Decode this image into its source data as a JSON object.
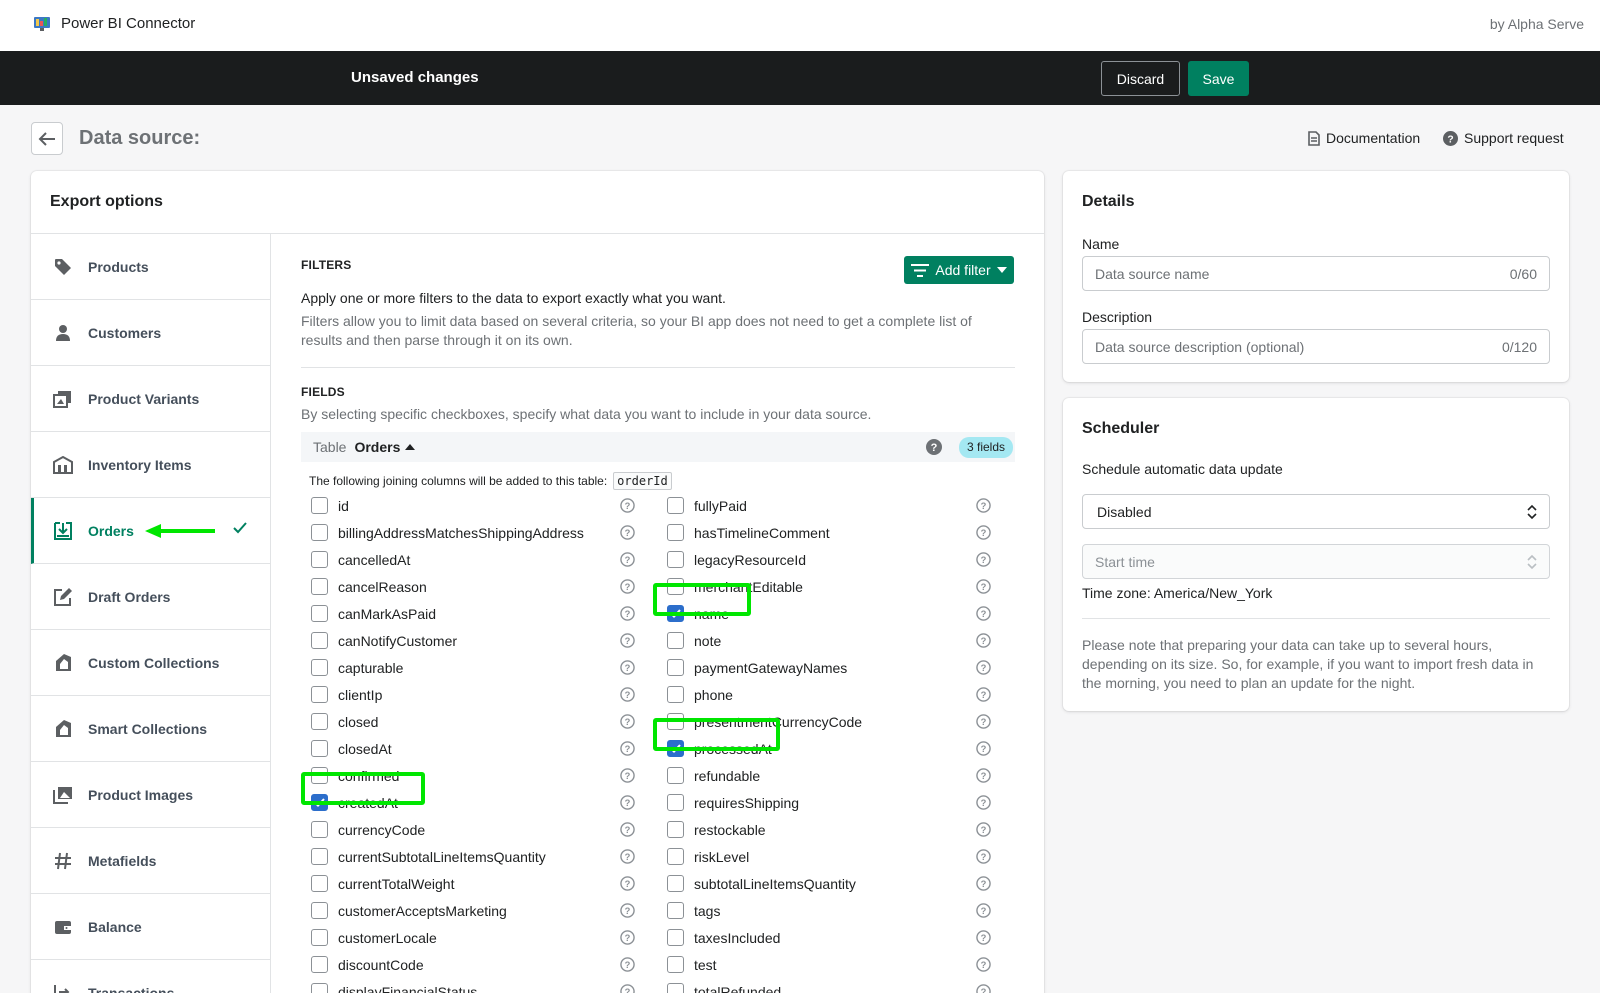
{
  "app": {
    "title": "Power BI Connector",
    "vendor": "by Alpha Serve"
  },
  "savebar": {
    "message": "Unsaved changes",
    "discard": "Discard",
    "save": "Save"
  },
  "page": {
    "title": "Data source:",
    "documentation": "Documentation",
    "support": "Support request"
  },
  "export": {
    "title": "Export options",
    "sidebar": [
      {
        "label": "Products",
        "icon": "tag-icon"
      },
      {
        "label": "Customers",
        "icon": "person-icon"
      },
      {
        "label": "Product Variants",
        "icon": "variants-icon"
      },
      {
        "label": "Inventory Items",
        "icon": "inventory-icon"
      },
      {
        "label": "Orders",
        "icon": "orders-icon",
        "active": true
      },
      {
        "label": "Draft Orders",
        "icon": "draft-orders-icon"
      },
      {
        "label": "Custom Collections",
        "icon": "collections-icon"
      },
      {
        "label": "Smart Collections",
        "icon": "collections-icon"
      },
      {
        "label": "Product Images",
        "icon": "images-icon"
      },
      {
        "label": "Metafields",
        "icon": "hash-icon"
      },
      {
        "label": "Balance",
        "icon": "wallet-icon"
      },
      {
        "label": "Transactions",
        "icon": "transactions-icon"
      }
    ],
    "filters": {
      "title": "FILTERS",
      "add_filter": "Add filter",
      "line1": "Apply one or more filters to the data to export exactly what you want.",
      "line2": "Filters allow you to limit data based on several criteria, so your BI app does not need to get a complete list of results and then parse through it on its own."
    },
    "fields": {
      "title": "FIELDS",
      "description": "By selecting specific checkboxes, specify what data you want to include in your data source.",
      "table_label": "Table",
      "table_name": "Orders",
      "count_badge": "3 fields",
      "join_note": "The following joining columns will be added to this table:",
      "join_column": "orderId",
      "left": [
        {
          "name": "id",
          "checked": false
        },
        {
          "name": "billingAddressMatchesShippingAddress",
          "checked": false
        },
        {
          "name": "cancelledAt",
          "checked": false
        },
        {
          "name": "cancelReason",
          "checked": false
        },
        {
          "name": "canMarkAsPaid",
          "checked": false
        },
        {
          "name": "canNotifyCustomer",
          "checked": false
        },
        {
          "name": "capturable",
          "checked": false
        },
        {
          "name": "clientIp",
          "checked": false
        },
        {
          "name": "closed",
          "checked": false
        },
        {
          "name": "closedAt",
          "checked": false
        },
        {
          "name": "confirmed",
          "checked": false
        },
        {
          "name": "createdAt",
          "checked": true
        },
        {
          "name": "currencyCode",
          "checked": false
        },
        {
          "name": "currentSubtotalLineItemsQuantity",
          "checked": false
        },
        {
          "name": "currentTotalWeight",
          "checked": false
        },
        {
          "name": "customerAcceptsMarketing",
          "checked": false
        },
        {
          "name": "customerLocale",
          "checked": false
        },
        {
          "name": "discountCode",
          "checked": false
        },
        {
          "name": "displayFinancialStatus",
          "checked": false
        }
      ],
      "right": [
        {
          "name": "fullyPaid",
          "checked": false
        },
        {
          "name": "hasTimelineComment",
          "checked": false
        },
        {
          "name": "legacyResourceId",
          "checked": false
        },
        {
          "name": "merchantEditable",
          "checked": false
        },
        {
          "name": "name",
          "checked": true
        },
        {
          "name": "note",
          "checked": false
        },
        {
          "name": "paymentGatewayNames",
          "checked": false
        },
        {
          "name": "phone",
          "checked": false
        },
        {
          "name": "presentmentCurrencyCode",
          "checked": false
        },
        {
          "name": "processedAt",
          "checked": true
        },
        {
          "name": "refundable",
          "checked": false
        },
        {
          "name": "requiresShipping",
          "checked": false
        },
        {
          "name": "restockable",
          "checked": false
        },
        {
          "name": "riskLevel",
          "checked": false
        },
        {
          "name": "subtotalLineItemsQuantity",
          "checked": false
        },
        {
          "name": "tags",
          "checked": false
        },
        {
          "name": "taxesIncluded",
          "checked": false
        },
        {
          "name": "test",
          "checked": false
        },
        {
          "name": "totalRefunded",
          "checked": false
        }
      ]
    }
  },
  "details": {
    "title": "Details",
    "name_label": "Name",
    "name_placeholder": "Data source name",
    "name_counter": "0/60",
    "desc_label": "Description",
    "desc_placeholder": "Data source description (optional)",
    "desc_counter": "0/120"
  },
  "scheduler": {
    "title": "Scheduler",
    "subtitle": "Schedule automatic data update",
    "select_value": "Disabled",
    "start_time_placeholder": "Start time",
    "timezone": "Time zone: America/New_York",
    "note": "Please note that preparing your data can take up to several hours, depending on its size. So, for example, if you want to import fresh data in the morning, you need to plan an update for the night."
  },
  "colors": {
    "primary": "#008060",
    "highlight": "#00e600",
    "checkbox": "#2c6ecb",
    "savebar": "#1a1c1d"
  }
}
